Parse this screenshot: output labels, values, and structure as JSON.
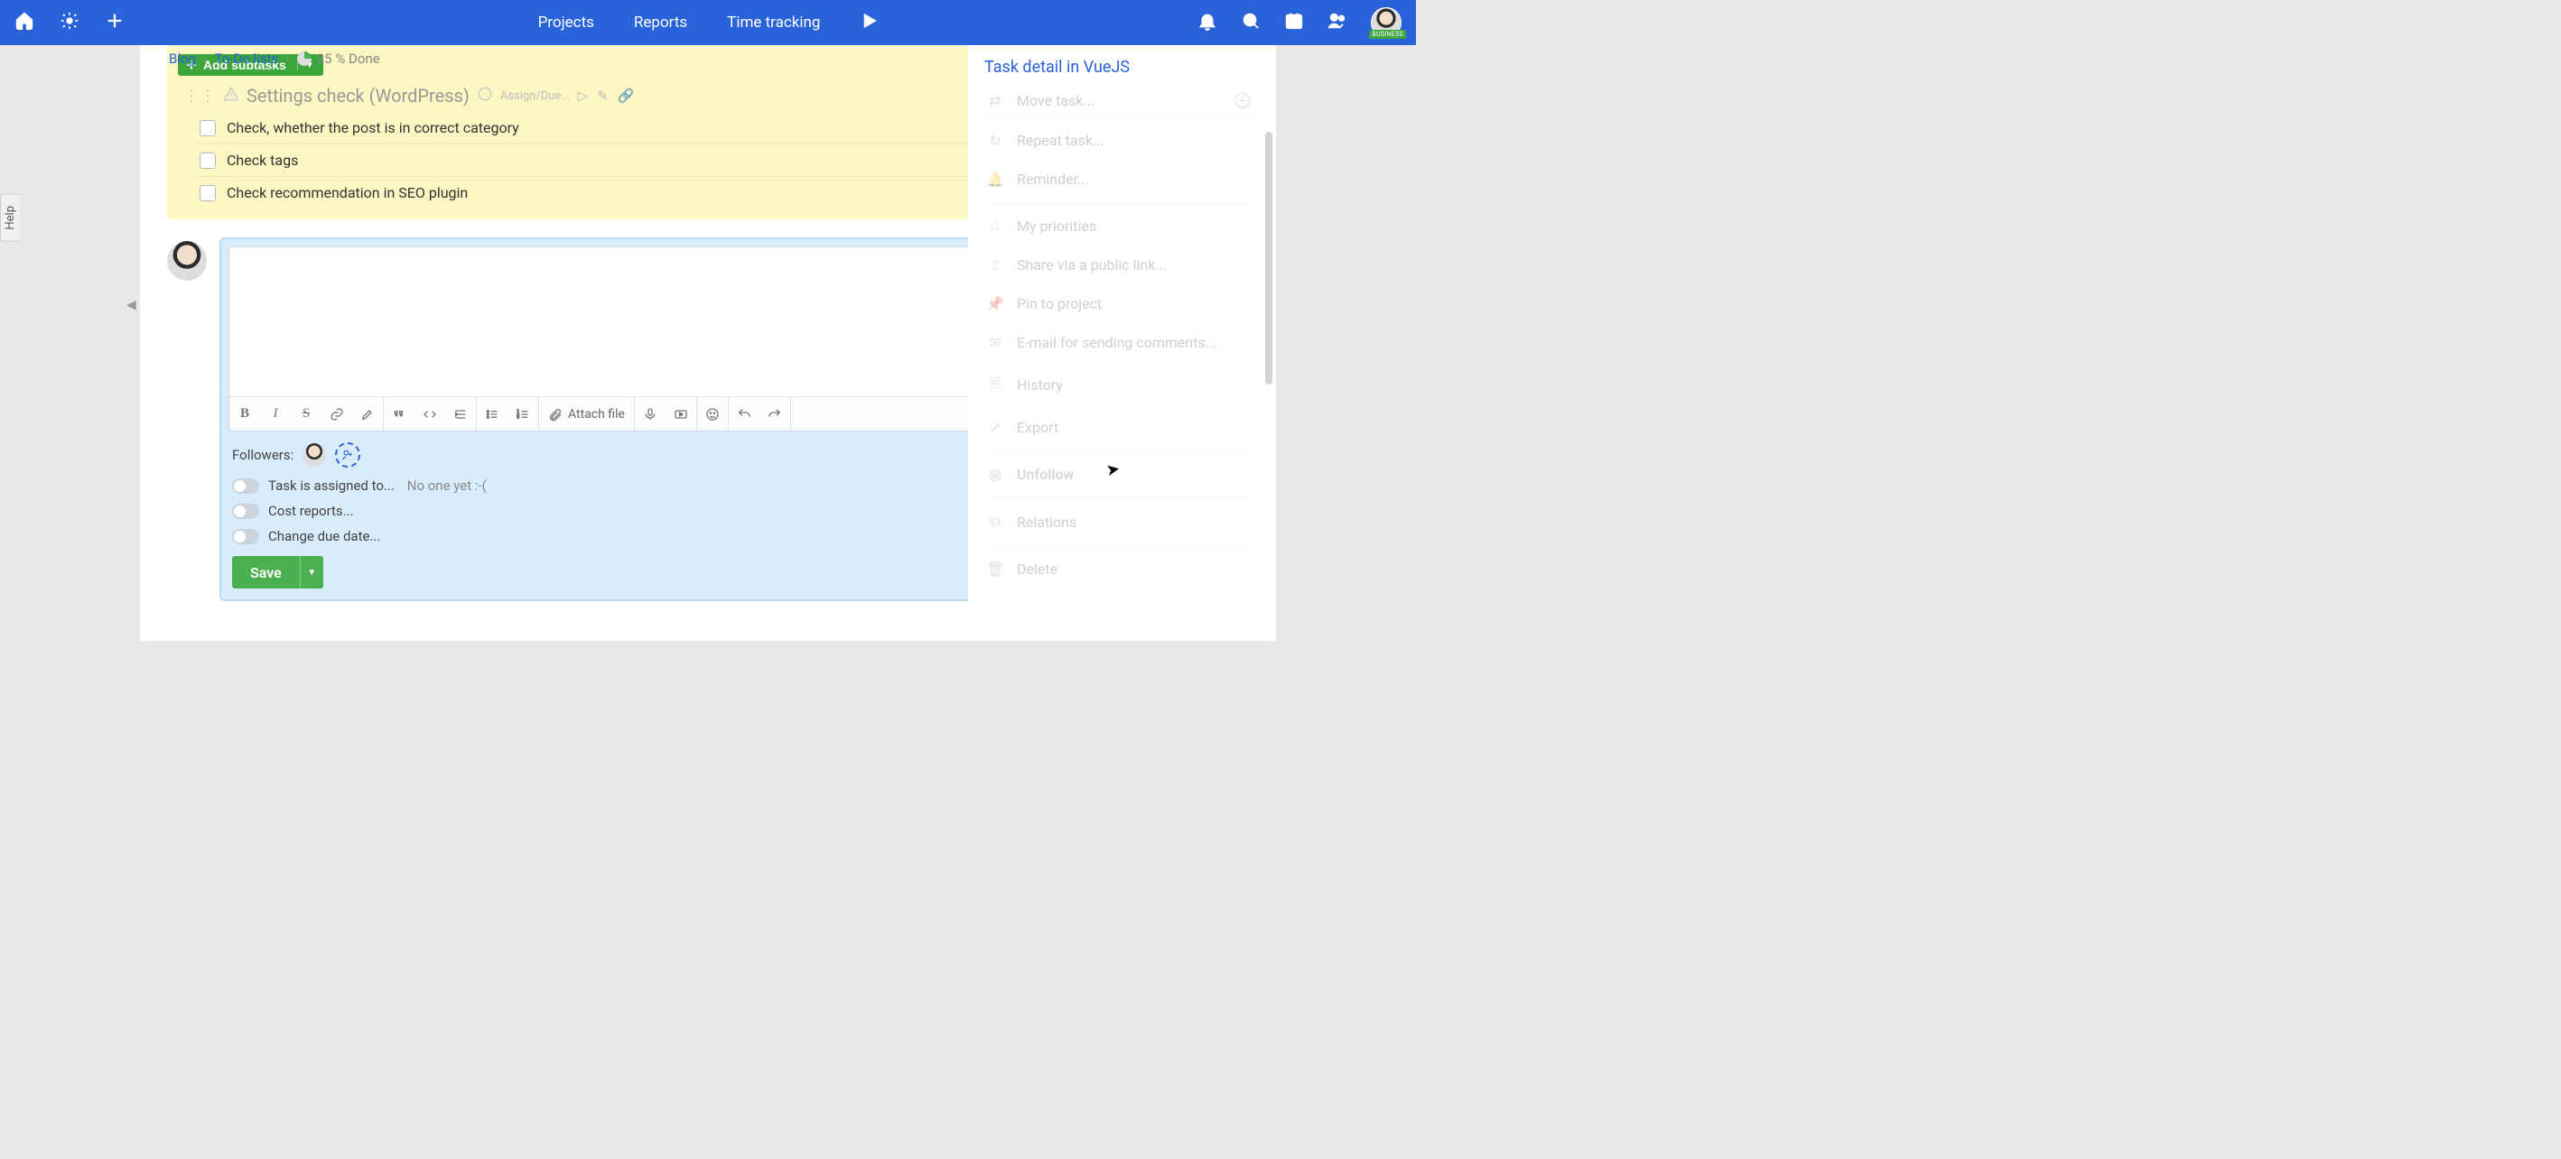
{
  "topnav": {
    "projects": "Projects",
    "reports": "Reports",
    "time_tracking": "Time tracking"
  },
  "avatar_badge": "BUSINESS",
  "help_tab": "Help",
  "breadcrumb": {
    "project": "Blog",
    "list": "To-Do lists",
    "progress_pct": "25 % Done"
  },
  "subtasks": {
    "add_button": "Add subtasks",
    "parent_title": "Settings check (WordPress)",
    "assign_due": "Assign/Due...",
    "items": [
      "Check, whether the post is in correct category",
      "Check tags",
      "Check recommendation in SEO plugin"
    ]
  },
  "comment": {
    "attach_label": "Attach file",
    "followers_label": "Followers:",
    "assigned_label": "Task is assigned to...",
    "assigned_value": "No one yet :-(",
    "cost_reports": "Cost reports...",
    "due_date": "Change due date...",
    "save": "Save"
  },
  "right": {
    "title": "Task detail in VueJS",
    "move": "Move task...",
    "repeat": "Repeat task...",
    "reminder": "Reminder...",
    "priorities": "My priorities",
    "share": "Share via a public link...",
    "pin": "Pin to project",
    "email": "E-mail for sending comments...",
    "history": "History",
    "export": "Export",
    "unfollow": "Unfollow",
    "relations": "Relations",
    "delete": "Delete"
  }
}
